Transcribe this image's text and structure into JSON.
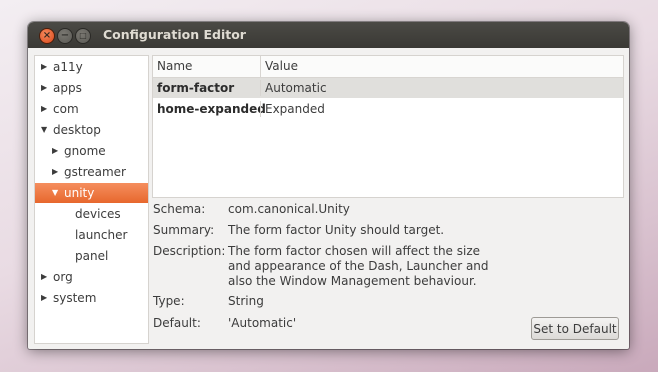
{
  "window": {
    "title": "Configuration Editor",
    "controls": {
      "close": "×",
      "minimize": "−",
      "maximize": "□"
    }
  },
  "tree": {
    "items": [
      {
        "label": "a11y",
        "expanded": false,
        "has_children": true
      },
      {
        "label": "apps",
        "expanded": false,
        "has_children": true
      },
      {
        "label": "com",
        "expanded": false,
        "has_children": true
      },
      {
        "label": "desktop",
        "expanded": true,
        "has_children": true
      },
      {
        "label": "gnome",
        "expanded": false,
        "has_children": true
      },
      {
        "label": "gstreamer",
        "expanded": false,
        "has_children": true
      },
      {
        "label": "unity",
        "expanded": true,
        "has_children": true,
        "selected": true
      },
      {
        "label": "devices",
        "has_children": false
      },
      {
        "label": "launcher",
        "has_children": false
      },
      {
        "label": "panel",
        "has_children": false
      },
      {
        "label": "org",
        "expanded": false,
        "has_children": true
      },
      {
        "label": "system",
        "expanded": false,
        "has_children": true
      }
    ],
    "arrow_collapsed": "▶",
    "arrow_expanded": "▼"
  },
  "table": {
    "headers": {
      "name": "Name",
      "value": "Value"
    },
    "rows": [
      {
        "name": "form-factor",
        "value": "Automatic",
        "selected": true
      },
      {
        "name": "home-expanded",
        "value": "Expanded",
        "selected": false
      }
    ]
  },
  "details": {
    "schema_label": "Schema:",
    "schema": "com.canonical.Unity",
    "summary_label": "Summary:",
    "summary": "The form factor Unity should target.",
    "description_label": "Description:",
    "description_lines": [
      "The form factor chosen will affect the size",
      "and appearance of the Dash, Launcher and",
      "also the Window Management behaviour."
    ],
    "type_label": "Type:",
    "type": "String",
    "default_label": "Default:",
    "default": "'Automatic'"
  },
  "buttons": {
    "set_default": "Set to Default"
  },
  "colors": {
    "selection_accent": "#e7672d",
    "titlebar": "#3c3b37"
  }
}
